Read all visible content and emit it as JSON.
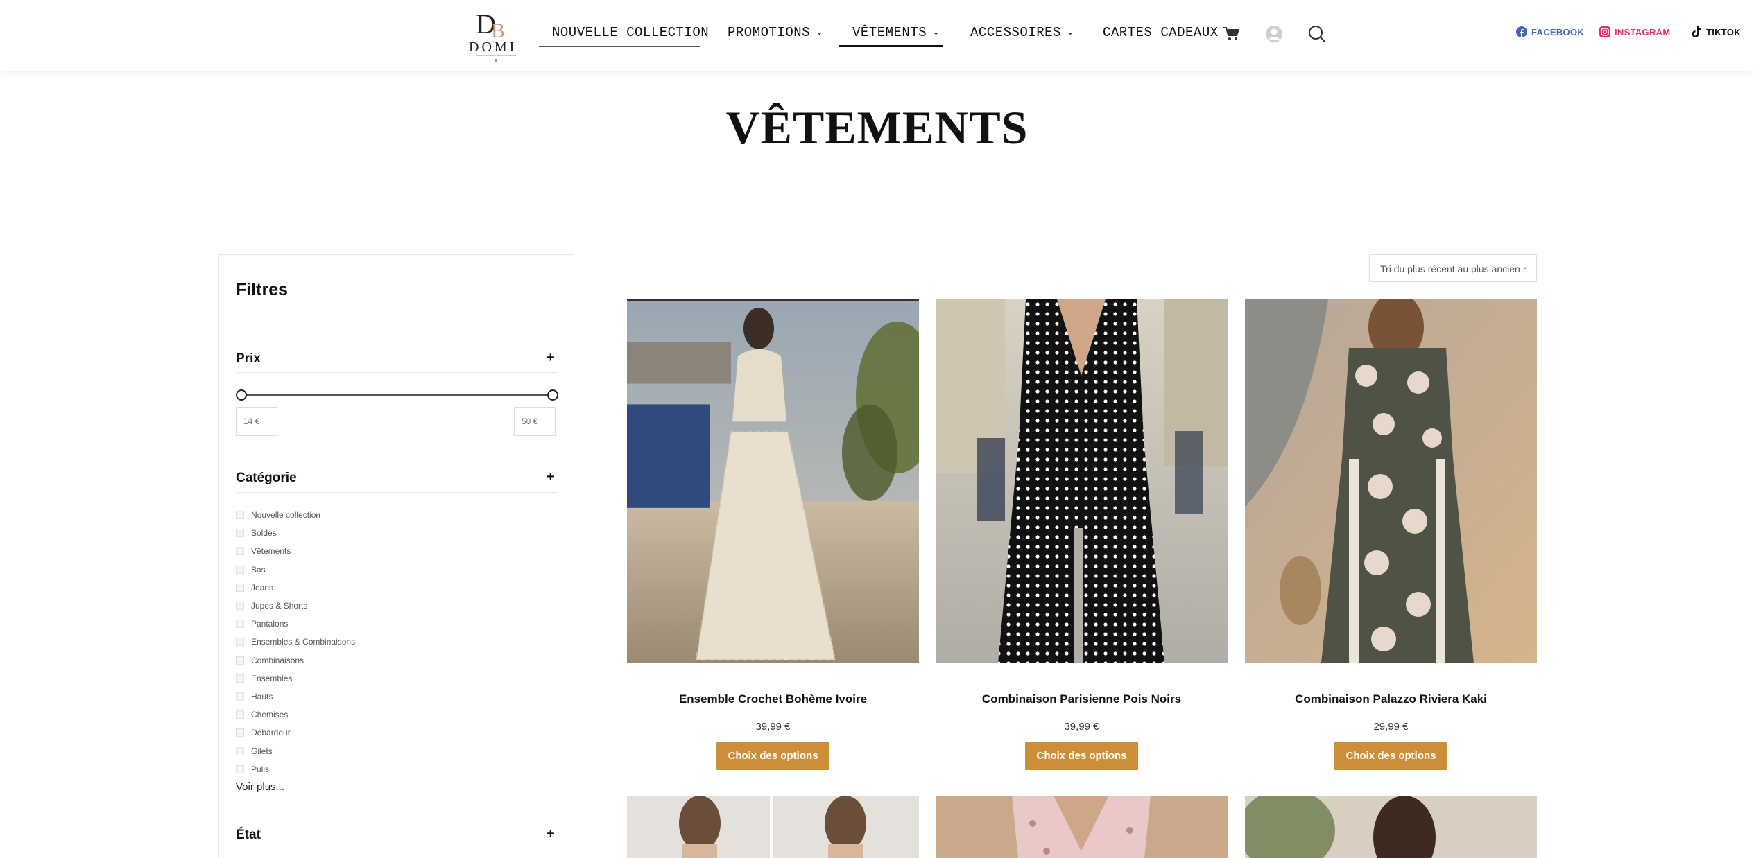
{
  "header": {
    "nav": [
      {
        "label": "NOUVELLE COLLECTION",
        "has_dropdown": false
      },
      {
        "label": "PROMOTIONS",
        "has_dropdown": true
      },
      {
        "label": "VÊTEMENTS",
        "has_dropdown": true
      },
      {
        "label": "ACCESSOIRES",
        "has_dropdown": true
      },
      {
        "label": "CARTES CADEAUX",
        "has_dropdown": false
      }
    ],
    "chevron": "⌄",
    "social": [
      {
        "label": "FACEBOOK",
        "color": "#4267B2",
        "icon": "facebook-icon"
      },
      {
        "label": "INSTAGRAM",
        "color": "#E1306C",
        "icon": "instagram-icon"
      },
      {
        "label": "TIKTOK",
        "color": "#111111",
        "icon": "tiktok-icon"
      }
    ]
  },
  "page": {
    "title": "VÊTEMENTS"
  },
  "filters": {
    "title": "Filtres",
    "price": {
      "title": "Prix",
      "min_label": "14 €",
      "max_label": "50 €"
    },
    "category": {
      "title": "Catégorie",
      "items": [
        "Nouvelle collection",
        "Soldes",
        "Vêtements",
        "Bas",
        "Jeans",
        "Jupes & Shorts",
        "Pantalons",
        "Ensembles & Combinaisons",
        "Combinaisons",
        "Ensembles",
        "Hauts",
        "Chemises",
        "Débardeur",
        "Gilets",
        "Pulls"
      ],
      "more": "Voir plus..."
    },
    "state": {
      "title": "État"
    },
    "expand_symbol": "+"
  },
  "sort": {
    "label": "Tri du plus récent au plus ancien",
    "chevron": "⌄"
  },
  "products": [
    {
      "name": "Ensemble Crochet Bohème Ivoire",
      "price": "39,99 €",
      "button": "Choix des options"
    },
    {
      "name": "Combinaison Parisienne Pois Noirs",
      "price": "39,99 €",
      "button": "Choix des options"
    },
    {
      "name": "Combinaison Palazzo Riviera Kaki",
      "price": "29,99 €",
      "button": "Choix des options"
    }
  ],
  "colors": {
    "accent": "#cc8f38"
  }
}
